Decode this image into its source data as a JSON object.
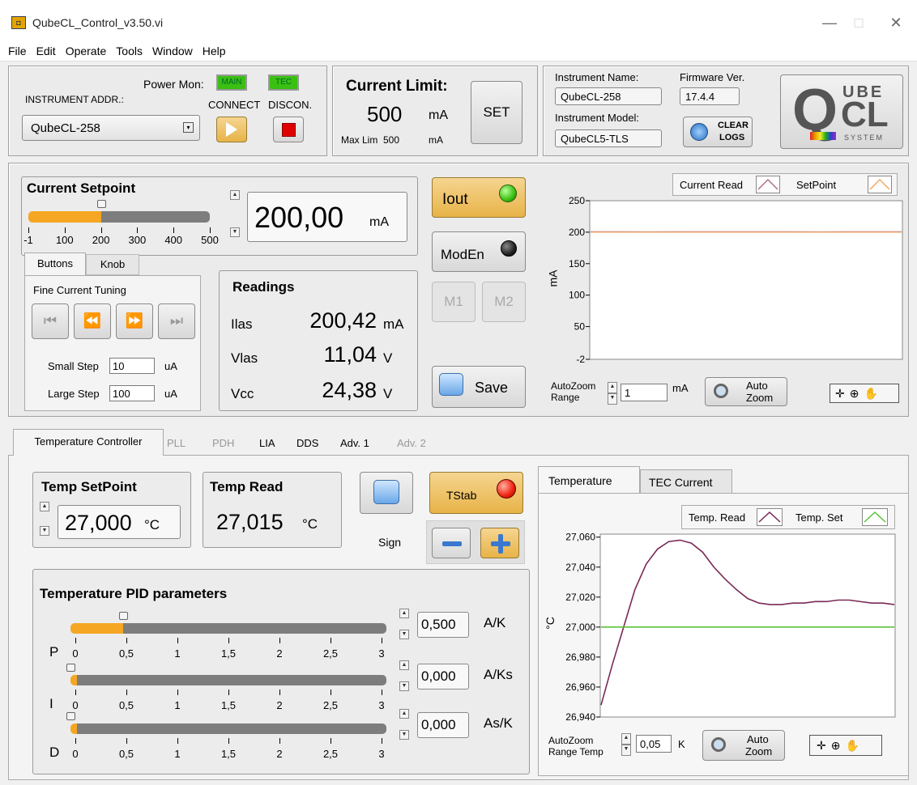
{
  "window": {
    "title": "QubeCL_Control_v3.50.vi",
    "icon_glyph": "◘",
    "minimize": "—",
    "maximize": "□",
    "close": "✕"
  },
  "menu": [
    "File",
    "Edit",
    "Operate",
    "Tools",
    "Window",
    "Help"
  ],
  "instrument": {
    "addr_label": "INSTRUMENT ADDR.:",
    "addr_value": "QubeCL-258",
    "power_mon_label": "Power Mon:",
    "main_badge": "MAIN",
    "tec_badge": "TEC",
    "connect_label": "CONNECT",
    "disconnect_label": "DISCON."
  },
  "current_limit": {
    "title": "Current Limit:",
    "value": "500",
    "unit": "mA",
    "set_label": "SET",
    "max_label": "Max Lim",
    "max_value": "500",
    "max_unit": "mA"
  },
  "info": {
    "name_label": "Instrument Name:",
    "name_value": "QubeCL-258",
    "fw_label": "Firmware Ver.",
    "fw_value": "17.4.4",
    "model_label": "Instrument Model:",
    "model_value": "QubeCL5-TLS",
    "clear_logs_line1": "CLEAR",
    "clear_logs_line2": "LOGS"
  },
  "logo": {
    "line1": "UBE",
    "line2": "CL",
    "sub": "SYSTEM",
    "big_letter": "Q"
  },
  "setpoint": {
    "title": "Current Setpoint",
    "value": "200,00",
    "unit": "mA",
    "slider_level": 0.4,
    "ticks": [
      "-1",
      "100",
      "200",
      "300",
      "400",
      "500"
    ]
  },
  "tuning": {
    "tabs": [
      "Buttons",
      "Knob"
    ],
    "title": "Fine Current Tuning",
    "buttons": [
      "⏮",
      "⏪",
      "⏩",
      "⏭"
    ],
    "small_step_label": "Small Step",
    "small_step_value": "10",
    "small_step_unit": "uA",
    "large_step_label": "Large Step",
    "large_step_value": "100",
    "large_step_unit": "uA"
  },
  "readings": {
    "title": "Readings",
    "rows": [
      {
        "label": "Ilas",
        "value": "200,42",
        "unit": "mA"
      },
      {
        "label": "Vlas",
        "value": "11,04",
        "unit": "V"
      },
      {
        "label": "Vcc",
        "value": "24,38",
        "unit": "V"
      }
    ]
  },
  "controls": {
    "iout": "Iout",
    "moden": "ModEn",
    "m1": "M1",
    "m2": "M2",
    "save": "Save"
  },
  "current_chart": {
    "legend_read": "Current Read",
    "legend_set": "SetPoint",
    "ylabel": "mA",
    "autozoom_label1": "AutoZoom",
    "autozoom_label2": "Range",
    "autozoom_value": "1",
    "autozoom_unit": "mA",
    "auto_zoom_btn1": "Auto",
    "auto_zoom_btn2": "Zoom",
    "colors": {
      "read": "#b07080",
      "set": "#f0a860"
    }
  },
  "bottom_tabs": [
    "Temperature Controller",
    "PLL",
    "PDH",
    "LIA",
    "DDS",
    "Adv. 1",
    "Adv. 2"
  ],
  "temp": {
    "setpoint_title": "Temp SetPoint",
    "setpoint_value": "27,000",
    "setpoint_unit": "°C",
    "read_title": "Temp Read",
    "read_value": "27,015",
    "read_unit": "°C",
    "tstab": "TStab",
    "sign_label": "Sign",
    "pid_title": "Temperature PID parameters",
    "pid": [
      {
        "name": "P",
        "value": "0,500",
        "unit": "A/K",
        "level": 0.1667
      },
      {
        "name": "I",
        "value": "0,000",
        "unit": "A/Ks",
        "level": 0.0
      },
      {
        "name": "D",
        "value": "0,000",
        "unit": "As/K",
        "level": 0.0
      }
    ],
    "pid_ticks": [
      "0",
      "0,5",
      "1",
      "1,5",
      "2",
      "2,5",
      "3"
    ]
  },
  "temp_chart_tabs": [
    "Temperature",
    "TEC Current"
  ],
  "temp_chart": {
    "legend_read": "Temp. Read",
    "legend_set": "Temp. Set",
    "ylabel": "°C",
    "autozoom_label1": "AutoZoom",
    "autozoom_label2": "Range Temp",
    "autozoom_value": "0,05",
    "autozoom_unit": "K",
    "auto_zoom_btn1": "Auto",
    "auto_zoom_btn2": "Zoom",
    "colors": {
      "read": "#7a2a55",
      "set": "#5ac43a"
    }
  },
  "chart_data": [
    {
      "type": "line",
      "ylabel": "mA",
      "ylim": [
        -2,
        250
      ],
      "yticks": [
        "250",
        "200",
        "150",
        "100",
        "50",
        "-2"
      ],
      "ytick_values": [
        250,
        200,
        150,
        100,
        50,
        -2
      ],
      "legend_placement": "top-right",
      "series": [
        {
          "name": "Current Read",
          "values": [
            200.4,
            200.5,
            200.3,
            200.4,
            200.5,
            200.4,
            200.4,
            200.5,
            200.3,
            200.4,
            200.4,
            200.5
          ]
        },
        {
          "name": "SetPoint",
          "values": [
            200,
            200,
            200,
            200,
            200,
            200,
            200,
            200,
            200,
            200,
            200,
            200
          ]
        }
      ]
    },
    {
      "type": "line",
      "ylabel": "°C",
      "ylim": [
        26.94,
        27.062
      ],
      "yticks": [
        "27,060",
        "27,040",
        "27,020",
        "27,000",
        "26,980",
        "26,960",
        "26,940"
      ],
      "ytick_values": [
        27.06,
        27.04,
        27.02,
        27.0,
        26.98,
        26.96,
        26.94
      ],
      "legend_placement": "top-right",
      "series": [
        {
          "name": "Temp. Read",
          "values": [
            26.948,
            26.975,
            27.0,
            27.025,
            27.042,
            27.052,
            27.057,
            27.058,
            27.056,
            27.05,
            27.04,
            27.032,
            27.025,
            27.019,
            27.016,
            27.015,
            27.015,
            27.016,
            27.016,
            27.017,
            27.017,
            27.018,
            27.018,
            27.017,
            27.016,
            27.016,
            27.015
          ]
        },
        {
          "name": "Temp. Set",
          "values": [
            27.0,
            27.0,
            27.0,
            27.0,
            27.0,
            27.0,
            27.0,
            27.0,
            27.0,
            27.0,
            27.0,
            27.0,
            27.0,
            27.0,
            27.0,
            27.0,
            27.0,
            27.0,
            27.0,
            27.0,
            27.0,
            27.0,
            27.0,
            27.0,
            27.0,
            27.0,
            27.0
          ]
        }
      ]
    }
  ]
}
